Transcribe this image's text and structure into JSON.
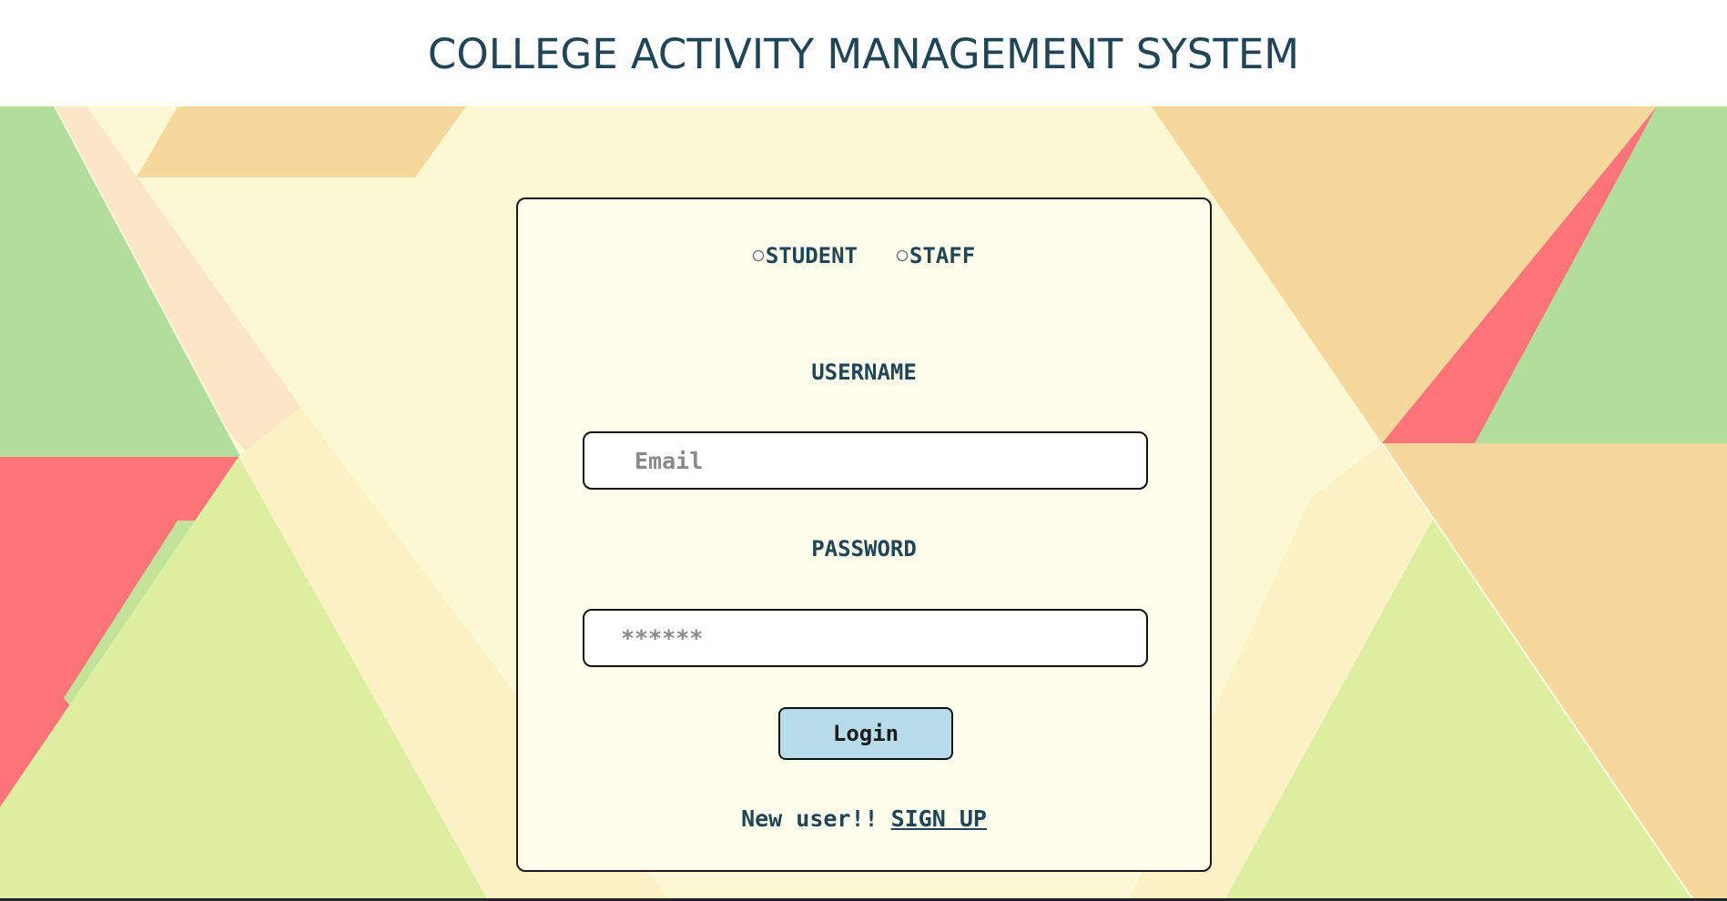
{
  "header": {
    "title": "COLLEGE ACTIVITY MANAGEMENT SYSTEM"
  },
  "login_form": {
    "roles": [
      {
        "label": "STUDENT",
        "selected": false
      },
      {
        "label": "STAFF",
        "selected": false
      }
    ],
    "username_label": "USERNAME",
    "email_placeholder": "Email",
    "password_label": "PASSWORD",
    "password_placeholder": "******",
    "login_button": "Login",
    "signup_prompt": "New user!!",
    "signup_link": "SIGN UP"
  },
  "colors": {
    "title_text": "#1f4556",
    "background_base": "#fdf8d4",
    "button_fill": "#b6dcea",
    "shape_green": "#b2dd9b",
    "shape_red": "#fe7479",
    "shape_orange": "#f6d79c",
    "shape_lime": "#dcefa0"
  }
}
